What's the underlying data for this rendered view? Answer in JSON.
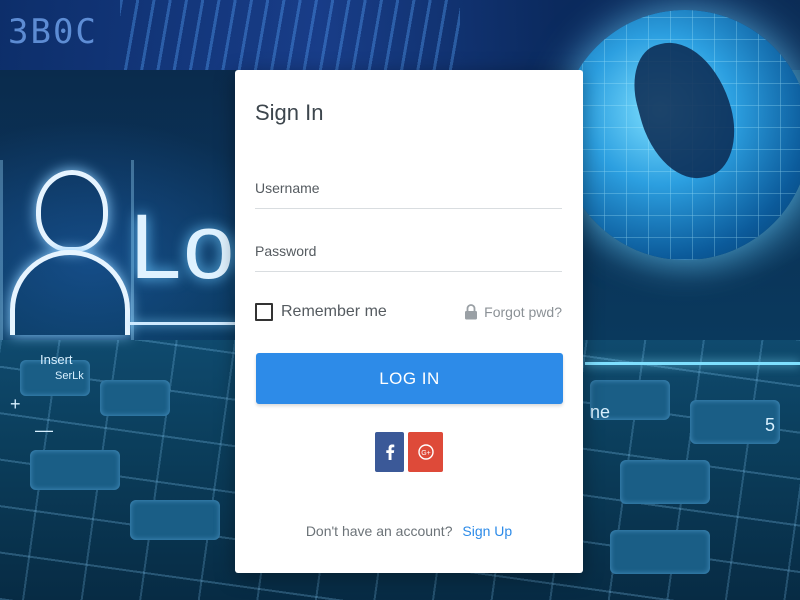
{
  "background": {
    "code_text": "3B0C",
    "log_text": "Log",
    "keys": [
      "Insert",
      "SerLk",
      "ne",
      "5",
      "+",
      "—"
    ]
  },
  "card": {
    "title": "Sign In",
    "username": {
      "placeholder": "Username",
      "value": ""
    },
    "password": {
      "placeholder": "Password",
      "value": ""
    },
    "remember_label": "Remember me",
    "forgot_label": "Forgot pwd?",
    "login_label": "LOG IN",
    "social": [
      {
        "name": "facebook",
        "label": "f",
        "color": "#3b5998"
      },
      {
        "name": "google-plus",
        "label": "G+",
        "color": "#de4a39"
      }
    ],
    "signup_prompt": "Don't have an account?",
    "signup_link": "Sign Up"
  },
  "colors": {
    "accent": "#2d8be8",
    "title": "#3d464d"
  }
}
